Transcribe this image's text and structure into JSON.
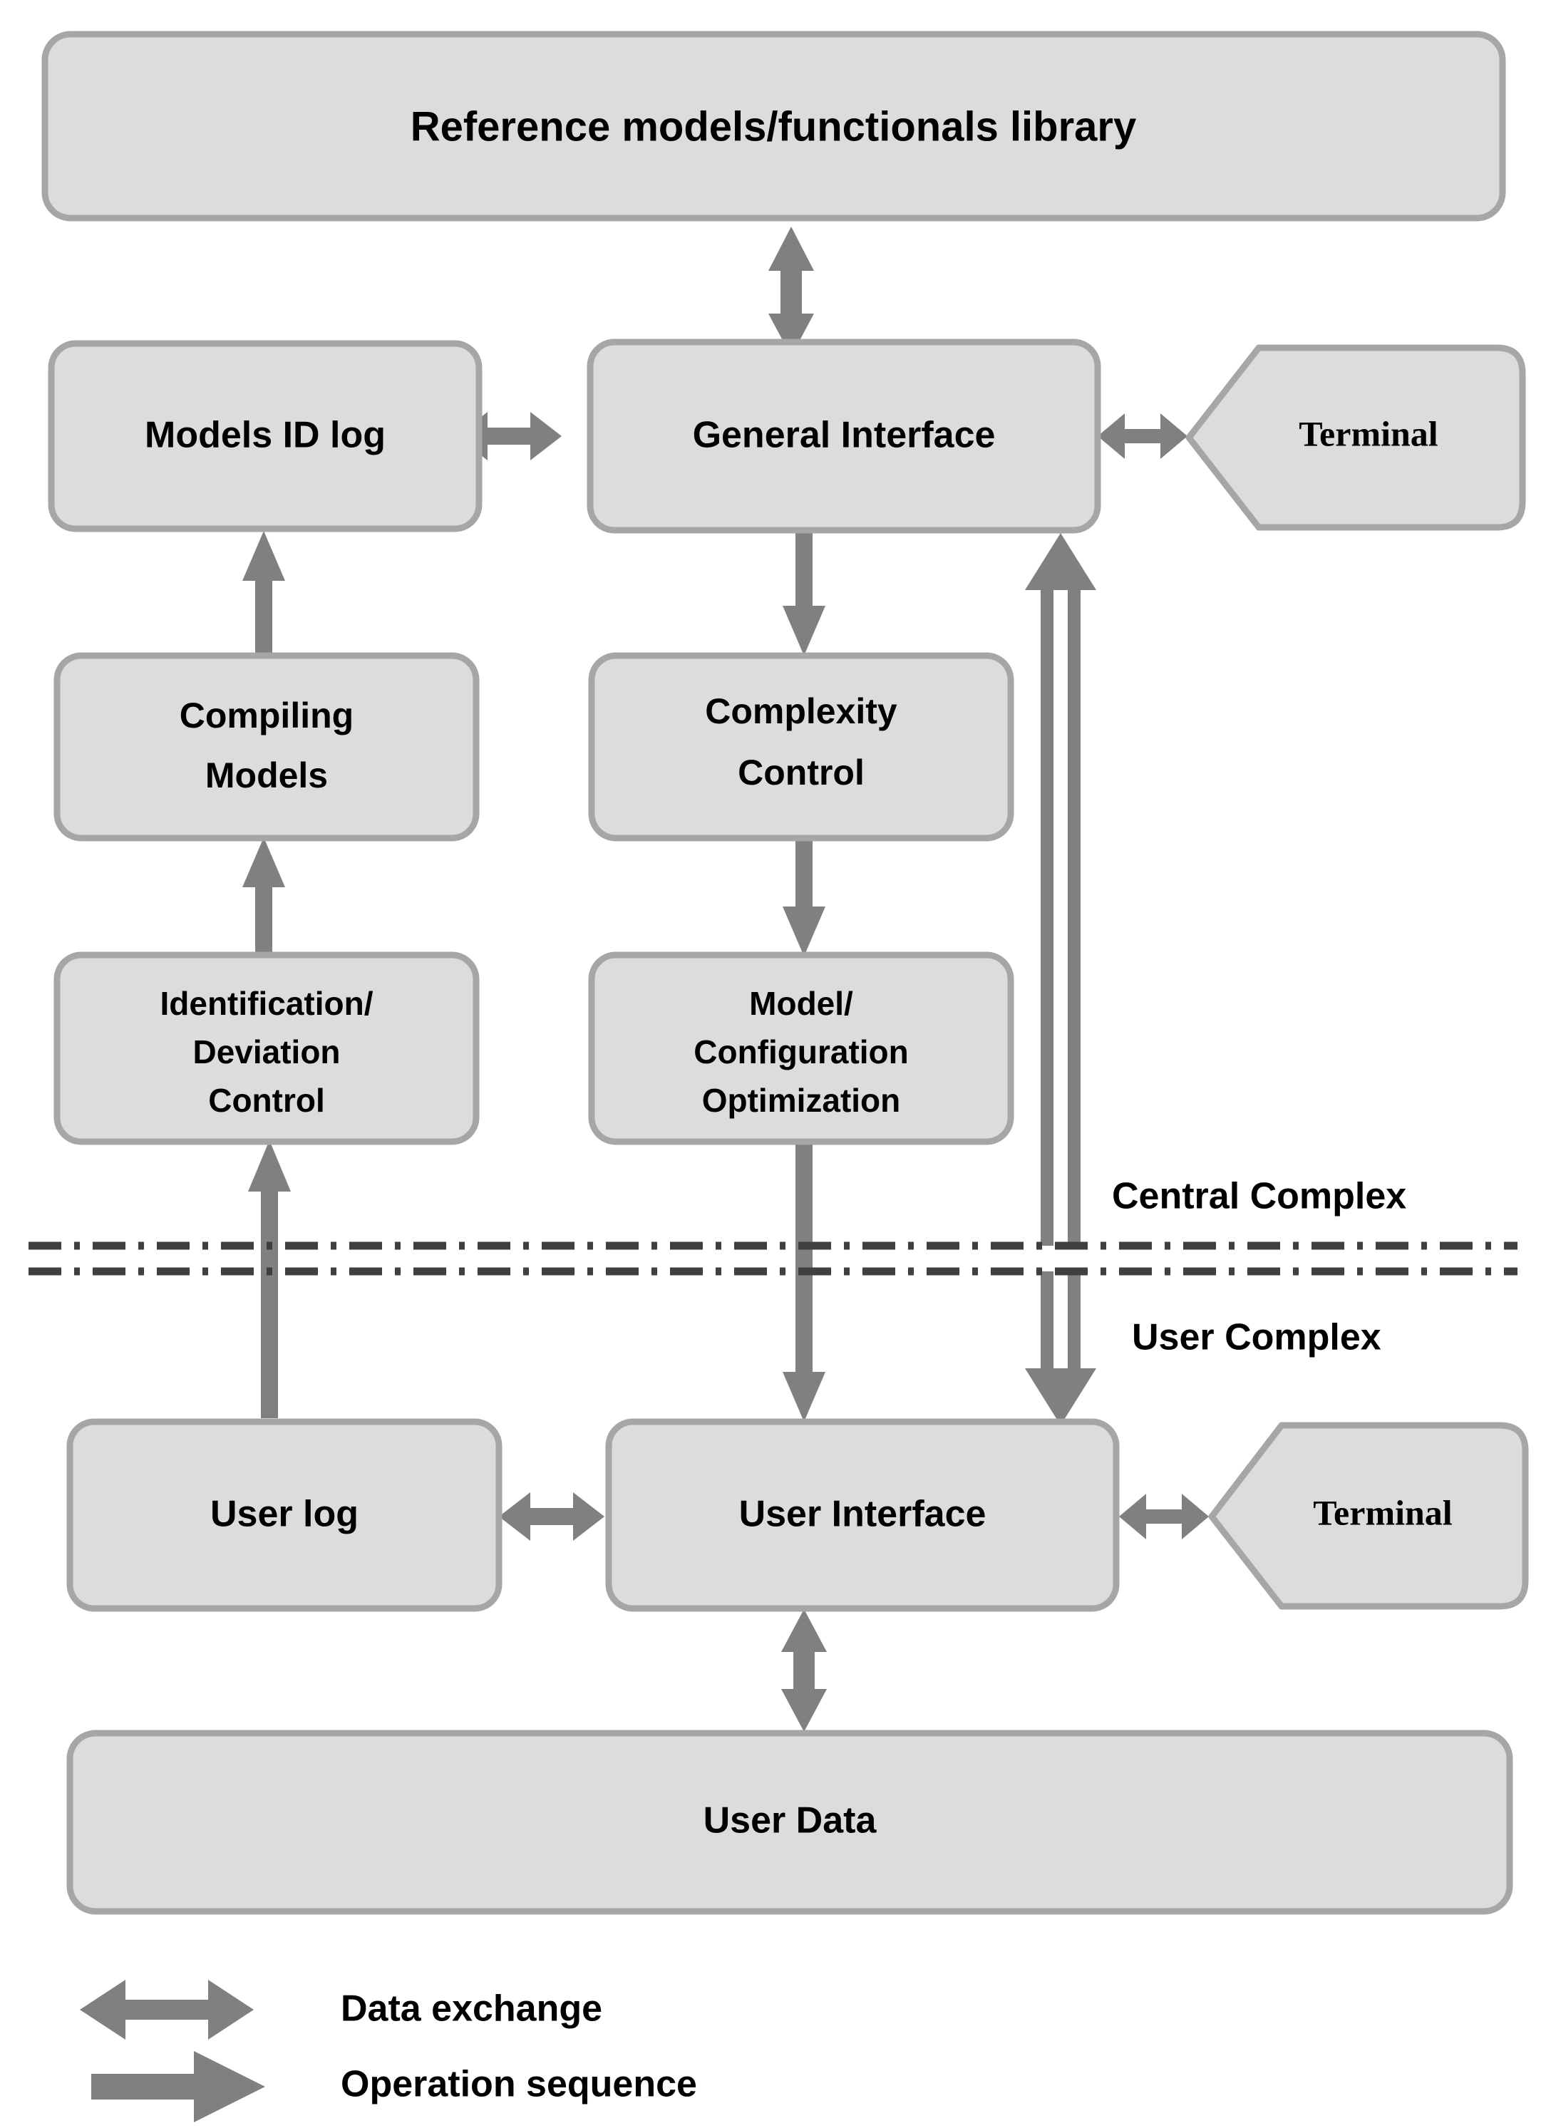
{
  "diagram": {
    "title": "Central/User complex architecture block diagram",
    "colors": {
      "box_fill": "#dcdcdc",
      "box_stroke": "#a6a6a6",
      "arrow_fill": "#808080",
      "divider": "#3f3f3f",
      "text": "#000000",
      "background": "#ffffff"
    },
    "zones": [
      {
        "id": "central",
        "label": "Central Complex"
      },
      {
        "id": "user",
        "label": "User Complex"
      }
    ],
    "nodes": [
      {
        "id": "reference-library",
        "label": "Reference models/functionals library",
        "shape": "rounded-rect",
        "font": "sans",
        "font_size": 58
      },
      {
        "id": "models-id-log",
        "label": "Models ID log",
        "shape": "rounded-rect",
        "font": "sans",
        "font_size": 52
      },
      {
        "id": "general-interface",
        "label": "General Interface",
        "shape": "rounded-rect",
        "font": "sans",
        "font_size": 52
      },
      {
        "id": "terminal-central",
        "label": "Terminal",
        "shape": "pentagon",
        "font": "serif",
        "font_size": 50
      },
      {
        "id": "compiling-models",
        "label": "Compiling\nModels",
        "line1": "Compiling",
        "line2": "Models",
        "shape": "rounded-rect",
        "font": "sans",
        "font_size": 50
      },
      {
        "id": "complexity-control",
        "label": "Complexity\nControl",
        "line1": "Complexity",
        "line2": "Control",
        "shape": "rounded-rect",
        "font": "sans",
        "font_size": 50
      },
      {
        "id": "identification-deviation-control",
        "label": "Identification/\nDeviation\nControl",
        "line1": "Identification/",
        "line2": "Deviation",
        "line3": "Control",
        "shape": "rounded-rect",
        "font": "sans",
        "font_size": 46
      },
      {
        "id": "model-configuration-optimization",
        "label": "Model/\nConfiguration\nOptimization",
        "line1": "Model/",
        "line2": "Configuration",
        "line3": "Optimization",
        "shape": "rounded-rect",
        "font": "sans",
        "font_size": 46
      },
      {
        "id": "user-log",
        "label": "User log",
        "shape": "rounded-rect",
        "font": "sans",
        "font_size": 52
      },
      {
        "id": "user-interface",
        "label": "User Interface",
        "shape": "rounded-rect",
        "font": "sans",
        "font_size": 52
      },
      {
        "id": "terminal-user",
        "label": "Terminal",
        "shape": "pentagon",
        "font": "serif",
        "font_size": 50
      },
      {
        "id": "user-data",
        "label": "User Data",
        "shape": "rounded-rect",
        "font": "sans",
        "font_size": 52
      }
    ],
    "edges": [
      {
        "id": "reference-library--general-interface",
        "from": "reference-library",
        "to": "general-interface",
        "type": "data-exchange",
        "orientation": "vertical"
      },
      {
        "id": "models-id-log--general-interface",
        "from": "models-id-log",
        "to": "general-interface",
        "type": "data-exchange",
        "orientation": "horizontal"
      },
      {
        "id": "general-interface--terminal-central",
        "from": "general-interface",
        "to": "terminal-central",
        "type": "data-exchange",
        "orientation": "horizontal"
      },
      {
        "id": "compiling-models--models-id-log",
        "from": "compiling-models",
        "to": "models-id-log",
        "type": "operation-sequence",
        "orientation": "up"
      },
      {
        "id": "identification--compiling-models",
        "from": "identification-deviation-control",
        "to": "compiling-models",
        "type": "operation-sequence",
        "orientation": "up"
      },
      {
        "id": "user-log--identification",
        "from": "user-log",
        "to": "identification-deviation-control",
        "type": "operation-sequence",
        "orientation": "up"
      },
      {
        "id": "general-interface--complexity-control",
        "from": "general-interface",
        "to": "complexity-control",
        "type": "operation-sequence",
        "orientation": "down"
      },
      {
        "id": "complexity-control--model-configuration",
        "from": "complexity-control",
        "to": "model-configuration-optimization",
        "type": "operation-sequence",
        "orientation": "down"
      },
      {
        "id": "model-configuration--user-interface",
        "from": "model-configuration-optimization",
        "to": "user-interface",
        "type": "operation-sequence",
        "orientation": "down"
      },
      {
        "id": "user-interface--general-interface",
        "from": "user-interface",
        "to": "general-interface",
        "type": "data-exchange",
        "orientation": "up"
      },
      {
        "id": "general-interface--user-interface",
        "from": "general-interface",
        "to": "user-interface",
        "type": "data-exchange",
        "orientation": "down"
      },
      {
        "id": "user-log--user-interface",
        "from": "user-log",
        "to": "user-interface",
        "type": "data-exchange",
        "orientation": "horizontal"
      },
      {
        "id": "user-interface--terminal-user",
        "from": "user-interface",
        "to": "terminal-user",
        "type": "data-exchange",
        "orientation": "horizontal"
      },
      {
        "id": "user-interface--user-data",
        "from": "user-interface",
        "to": "user-data",
        "type": "data-exchange",
        "orientation": "vertical"
      }
    ],
    "legend": {
      "items": [
        {
          "id": "data-exchange",
          "label": "Data exchange",
          "icon": "double-headed-arrow-icon"
        },
        {
          "id": "operation-sequence",
          "label": "Operation sequence",
          "icon": "right-arrow-icon"
        }
      ]
    }
  }
}
